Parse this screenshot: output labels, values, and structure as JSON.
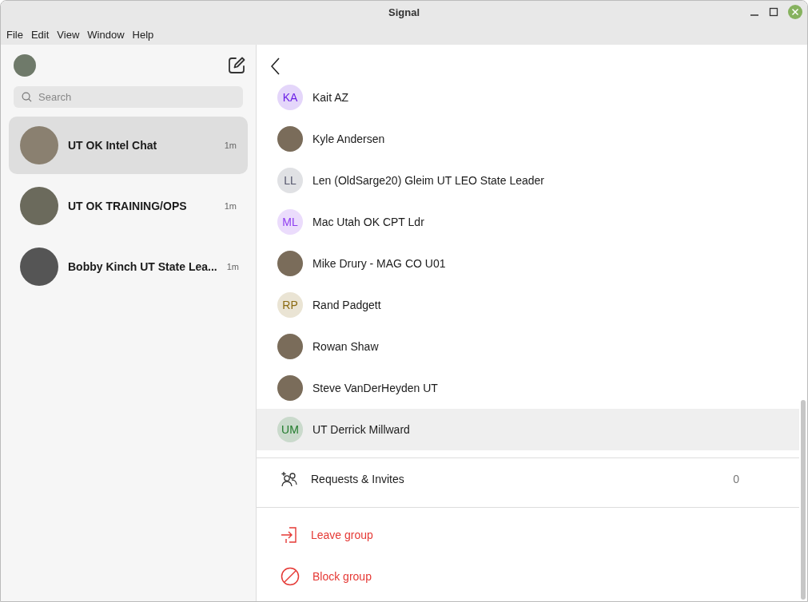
{
  "window": {
    "title": "Signal"
  },
  "menu": [
    "File",
    "Edit",
    "View",
    "Window",
    "Help"
  ],
  "search": {
    "placeholder": "Search"
  },
  "conversations": [
    {
      "name": "UT OK Intel Chat",
      "time": "1m",
      "selected": true
    },
    {
      "name": "UT OK TRAINING/OPS",
      "time": "1m",
      "selected": false
    },
    {
      "name": "Bobby Kinch UT State Lea...",
      "time": "1m",
      "selected": false
    }
  ],
  "members": [
    {
      "kind": "initials",
      "initials": "KA",
      "name": "Kait AZ",
      "color": "#6a1ee6",
      "hovered": false
    },
    {
      "kind": "photo",
      "name": "Kyle Andersen",
      "hovered": false
    },
    {
      "kind": "initials",
      "initials": "LL",
      "name": "Len (OldSarge20) Gleim UT LEO State Leader",
      "color": "#55566c",
      "hovered": false
    },
    {
      "kind": "initials",
      "initials": "ML",
      "name": "Mac Utah OK CPT Ldr",
      "color": "#8e3cf0",
      "hovered": false
    },
    {
      "kind": "photo",
      "name": "Mike Drury - MAG CO U01",
      "hovered": false
    },
    {
      "kind": "initials",
      "initials": "RP",
      "name": "Rand Padgett",
      "color": "#8a6a12",
      "hovered": false
    },
    {
      "kind": "photo",
      "name": "Rowan Shaw",
      "hovered": false
    },
    {
      "kind": "photo",
      "name": "Steve VanDerHeyden UT",
      "hovered": false
    },
    {
      "kind": "initials",
      "initials": "UM",
      "name": "UT Derrick Millward",
      "color": "#1f7a2a",
      "hovered": true
    }
  ],
  "requests": {
    "label": "Requests & Invites",
    "count": "0"
  },
  "actions": [
    {
      "kind": "leave",
      "label": "Leave group"
    },
    {
      "kind": "block",
      "label": "Block group"
    }
  ]
}
